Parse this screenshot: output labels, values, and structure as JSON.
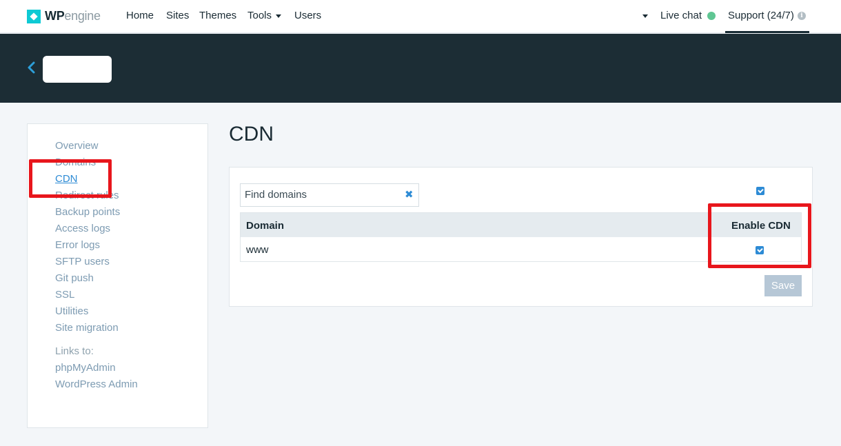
{
  "topnav": {
    "logo": {
      "brand_bold": "WP",
      "brand_light": "engine"
    },
    "links": [
      {
        "label": "Home"
      },
      {
        "label": "Sites"
      },
      {
        "label": "Themes"
      },
      {
        "label": "Tools"
      },
      {
        "label": "Users"
      }
    ],
    "live_chat": "Live chat",
    "support": "Support (24/7)",
    "info_glyph": "i"
  },
  "header": {
    "back_icon": "chevron-left-icon",
    "site_name_redacted": true
  },
  "sidebar": {
    "links": [
      {
        "label": "Overview"
      },
      {
        "label": "Domains"
      },
      {
        "label": "CDN",
        "active": true
      },
      {
        "label": "Redirect rules"
      },
      {
        "label": "Backup points"
      },
      {
        "label": "Access logs"
      },
      {
        "label": "Error logs"
      },
      {
        "label": "SFTP users"
      },
      {
        "label": "Git push"
      },
      {
        "label": "SSL"
      },
      {
        "label": "Utilities"
      },
      {
        "label": "Site migration"
      }
    ],
    "links_to_label": "Links to:",
    "external_links": [
      {
        "label": "phpMyAdmin"
      },
      {
        "label": "WordPress Admin"
      }
    ]
  },
  "main": {
    "title": "CDN",
    "search": {
      "placeholder": "Find domains",
      "clear_icon": "close-icon"
    },
    "select_all_checked": true,
    "table": {
      "headers": [
        "Domain",
        "Enable CDN"
      ],
      "rows": [
        {
          "domain": "www",
          "enable_cdn": true
        }
      ]
    },
    "save_label": "Save"
  },
  "colors": {
    "accent": "#2d8bd5",
    "header_bg": "#1c2d35",
    "live_status": "#5fc693",
    "highlight": "#e8161c"
  }
}
